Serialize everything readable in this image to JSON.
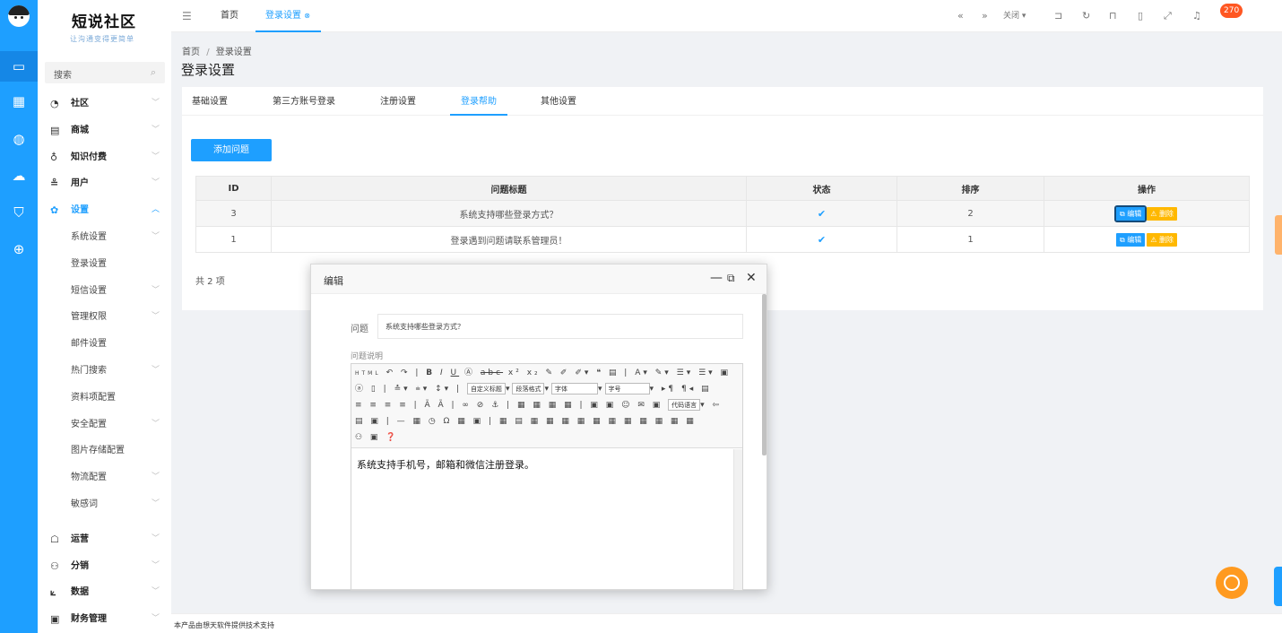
{
  "brand": {
    "logo": "短说社区",
    "slogan": "让沟通变得更简单"
  },
  "sidebar": {
    "search_placeholder": "搜索",
    "items": [
      {
        "label": "社区",
        "icon": "chat-icon",
        "chev": "﹀"
      },
      {
        "label": "商城",
        "icon": "shop-icon",
        "chev": "﹀"
      },
      {
        "label": "知识付费",
        "icon": "bulb-icon",
        "chev": "﹀"
      },
      {
        "label": "用户",
        "icon": "users-icon",
        "chev": "﹀"
      },
      {
        "label": "设置",
        "icon": "gear-icon",
        "chev": "︿"
      }
    ],
    "sub_items": [
      {
        "label": "系统设置",
        "chev": "﹀"
      },
      {
        "label": "登录设置",
        "chev": ""
      },
      {
        "label": "短信设置",
        "chev": "﹀"
      },
      {
        "label": "管理权限",
        "chev": "﹀"
      },
      {
        "label": "邮件设置",
        "chev": ""
      },
      {
        "label": "热门搜索",
        "chev": "﹀"
      },
      {
        "label": "资料项配置",
        "chev": ""
      },
      {
        "label": "安全配置",
        "chev": "﹀"
      },
      {
        "label": "图片存储配置",
        "chev": ""
      },
      {
        "label": "物流配置",
        "chev": "﹀"
      },
      {
        "label": "敏感词",
        "chev": "﹀"
      }
    ],
    "bottom_items": [
      {
        "label": "运营",
        "icon": "operation-icon",
        "chev": "﹀"
      },
      {
        "label": "分销",
        "icon": "distribution-icon",
        "chev": "﹀"
      },
      {
        "label": "数据",
        "icon": "chart-icon",
        "chev": "﹀"
      },
      {
        "label": "财务管理",
        "icon": "finance-icon",
        "chev": "﹀"
      }
    ]
  },
  "topbar": {
    "home_tab": "首页",
    "active_tab": "登录设置",
    "close_label": "关闭",
    "notification_count": "270"
  },
  "page": {
    "breadcrumb_home": "首页",
    "breadcrumb_sep": "/",
    "breadcrumb_current": "登录设置",
    "title": "登录设置"
  },
  "tabs": [
    "基础设置",
    "第三方账号登录",
    "注册设置",
    "登录帮助",
    "其他设置"
  ],
  "active_tab_index": 3,
  "add_button": "添加问题",
  "table": {
    "headers": [
      "ID",
      "问题标题",
      "状态",
      "排序",
      "操作"
    ],
    "rows": [
      {
        "id": "3",
        "title": "系统支持哪些登录方式？",
        "status": "✔",
        "sort": "2"
      },
      {
        "id": "1",
        "title": "登录遇到问题请联系管理员！",
        "status": "✔",
        "sort": "1"
      }
    ],
    "edit_label": "编辑",
    "delete_label": "删除"
  },
  "total": "共 2 项",
  "footer": "本产品由想天软件提供技术支持",
  "modal": {
    "title": "编辑",
    "question_label": "问题",
    "question_value": "系统支持哪些登录方式？",
    "desc_label": "问题说明",
    "content": "系统支持手机号，邮箱和微信注册登录。",
    "toolbar_selects": [
      "自定义标题",
      "段落格式",
      "字体",
      "字号",
      "代码语言"
    ]
  }
}
